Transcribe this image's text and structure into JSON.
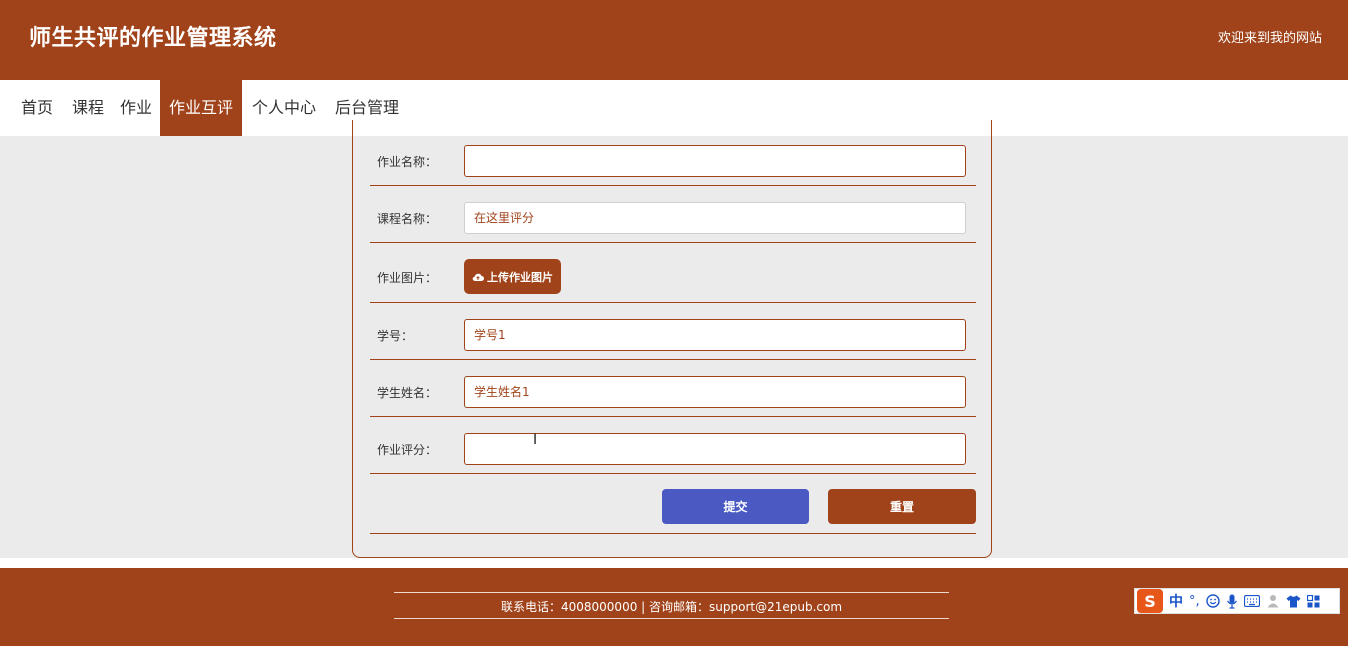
{
  "header": {
    "title": "师生共评的作业管理系统",
    "welcome": "欢迎来到我的网站"
  },
  "nav": {
    "items": [
      "首页",
      "课程",
      "作业",
      "作业互评",
      "个人中心",
      "后台管理"
    ],
    "active": "作业互评"
  },
  "form": {
    "homework_name": {
      "label": "作业名称：",
      "value": ""
    },
    "course_name": {
      "label": "课程名称：",
      "placeholder": "在这里评分"
    },
    "homework_image": {
      "label": "作业图片：",
      "button": "上传作业图片"
    },
    "student_id": {
      "label": "学号：",
      "value": "学号1"
    },
    "student_name": {
      "label": "学生姓名：",
      "value": "学生姓名1"
    },
    "score": {
      "label": "作业评分：",
      "value": ""
    },
    "submit_label": "提交",
    "reset_label": "重置"
  },
  "footer": {
    "text": "联系电话：4008000000 | 咨询邮箱：support@21epub.com"
  },
  "ime": {
    "logo": "S",
    "mode": "中",
    "punct": "°,"
  },
  "colors": {
    "brand": "#a0431a",
    "submit": "#4b59c2",
    "background": "#ebebeb"
  },
  "icons": [
    "cloud-upload-icon",
    "smiley-icon",
    "microphone-icon",
    "keyboard-icon",
    "person-icon",
    "shirt-icon",
    "grid-icon"
  ]
}
